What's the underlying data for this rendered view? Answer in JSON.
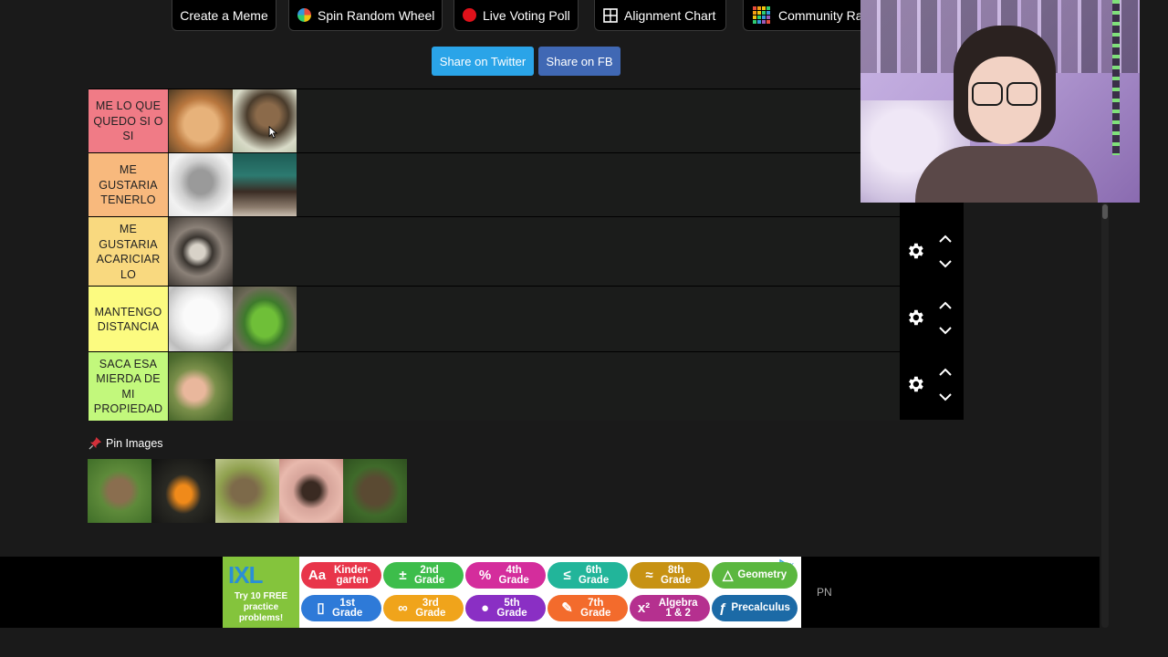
{
  "toolbar": {
    "create_meme": "Create a Meme",
    "spin_wheel": "Spin Random Wheel",
    "live_poll": "Live Voting Poll",
    "alignment_chart": "Alignment Chart",
    "community_rank": "Community Rar"
  },
  "share": {
    "twitter": "Share on Twitter",
    "facebook": "Share on FB"
  },
  "tiers": [
    {
      "label": "ME LO QUE QUEDO SI O SI",
      "color": "#f07b86"
    },
    {
      "label": "ME GUSTARIA TENERLO",
      "color": "#f8b97d"
    },
    {
      "label": "ME GUSTARIA ACARICIAR LO",
      "color": "#f9d97f"
    },
    {
      "label": "MANTENGO DISTANCIA",
      "color": "#fcfb80"
    },
    {
      "label": "SACA ESA MIERDA DE MI PROPIEDAD",
      "color": "#c2f87c"
    }
  ],
  "pin": {
    "label": "Pin Images",
    "icon": "pushpin-icon"
  },
  "ad": {
    "brand": "IXL",
    "tagline": "Try 10 FREE practice problems!",
    "grades": [
      {
        "label": "Kinder-garten",
        "icon": "Aa",
        "color": "#e8354a"
      },
      {
        "label": "2nd Grade",
        "icon": "±",
        "color": "#3dbd4b"
      },
      {
        "label": "4th Grade",
        "icon": "%",
        "color": "#d42d9c"
      },
      {
        "label": "6th Grade",
        "icon": "≤",
        "color": "#22b59a"
      },
      {
        "label": "8th Grade",
        "icon": "≈",
        "color": "#c79213"
      },
      {
        "label": "Geometry",
        "icon": "△",
        "color": "#5bb73f"
      },
      {
        "label": "1st Grade",
        "icon": "▯",
        "color": "#2e7ad8"
      },
      {
        "label": "3rd Grade",
        "icon": "∞",
        "color": "#f0a41b"
      },
      {
        "label": "5th Grade",
        "icon": "●",
        "color": "#8a2fc4"
      },
      {
        "label": "7th Grade",
        "icon": "✎",
        "color": "#f36b2c"
      },
      {
        "label": "Algebra 1 & 2",
        "icon": "x²",
        "color": "#b5308f"
      },
      {
        "label": "Precalculus",
        "icon": "ƒ",
        "color": "#1c6aa6"
      }
    ],
    "side_text": "PN"
  }
}
